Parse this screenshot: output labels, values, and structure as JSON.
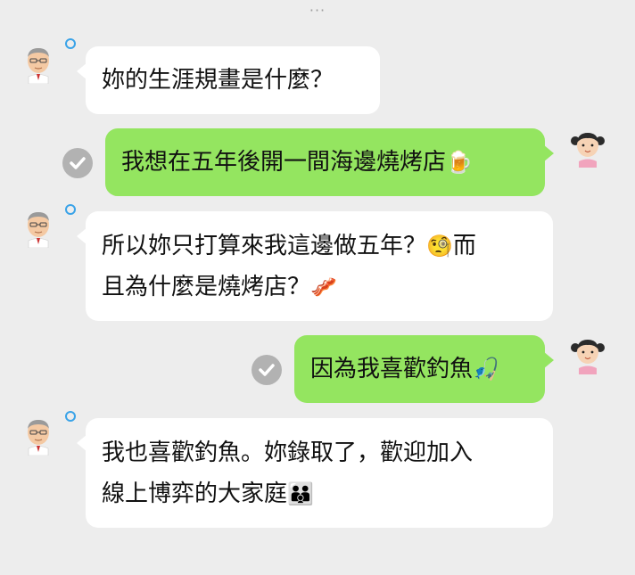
{
  "top_indicator": "···",
  "colors": {
    "background": "#ededed",
    "incoming_bubble": "#ffffff",
    "outgoing_bubble": "#94e560",
    "read_ring": "#3aa3e8",
    "check_circle": "#b2b2b2"
  },
  "messages": [
    {
      "sender": "teacher",
      "avatar_icon": "old-man-avatar-icon",
      "lines": [
        "妳的生涯規畫是什麼？"
      ]
    },
    {
      "sender": "student",
      "avatar_icon": "girl-avatar-icon",
      "status_icon": "check-circle-icon",
      "text": "我想在五年後開一間海邊燒烤店",
      "emoji": "🍺"
    },
    {
      "sender": "teacher",
      "avatar_icon": "old-man-avatar-icon",
      "line1_text": "所以妳只打算來我這邊做五年？",
      "line1_emoji": "🧐",
      "line1_tail": "而",
      "line2_text": "且為什麼是燒烤店？",
      "line2_emoji": "🥓"
    },
    {
      "sender": "student",
      "avatar_icon": "girl-avatar-icon",
      "status_icon": "check-circle-icon",
      "text": "因為我喜歡釣魚",
      "emoji": "🎣"
    },
    {
      "sender": "teacher",
      "avatar_icon": "old-man-avatar-icon",
      "line1_text": "我也喜歡釣魚。妳錄取了，歡迎加入",
      "line2_text": "線上博弈的大家庭",
      "line2_emoji": "👪"
    }
  ]
}
